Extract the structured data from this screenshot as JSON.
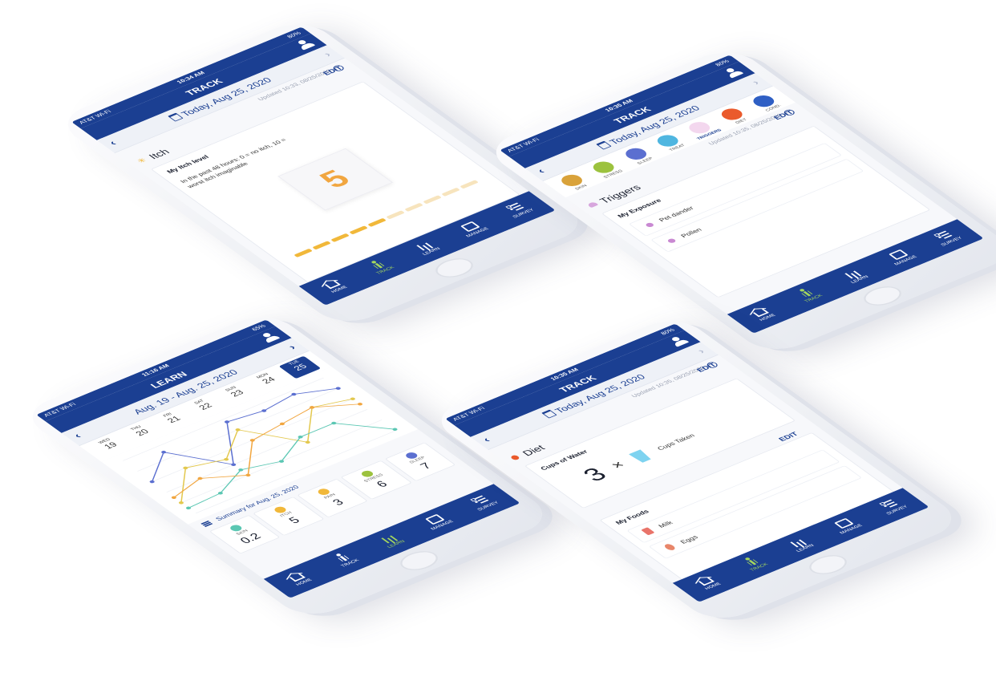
{
  "tabs": [
    "HOME",
    "TRACK",
    "LEARN",
    "MANAGE",
    "SURVEY"
  ],
  "track_itch": {
    "status": {
      "carrier": "AT&T Wi-Fi",
      "time": "10:34 AM",
      "battery": "80%"
    },
    "title": "TRACK",
    "date": "Today, Aug 25, 2020",
    "updated": "Updated 10:33, 08/25/2020",
    "section": "Itch",
    "edit": "EDIT",
    "card_title": "My Itch level",
    "question": "In the past 48 hours: 0 = no itch, 10 = worst itch imaginable",
    "value": "5",
    "scale_level": 0.5
  },
  "track_triggers": {
    "status": {
      "carrier": "AT&T Wi-Fi",
      "time": "10:35 AM",
      "battery": "80%"
    },
    "title": "TRACK",
    "date": "Today, Aug 25, 2020",
    "categories": [
      {
        "label": "SKIN",
        "color": "#d9a23a"
      },
      {
        "label": "STRESS",
        "color": "#9cc23e"
      },
      {
        "label": "SLEEP",
        "color": "#5b6fd0"
      },
      {
        "label": "TREAT",
        "color": "#4fb6e0"
      },
      {
        "label": "TRIGGERS",
        "color": "#f3d7ee"
      },
      {
        "label": "DIET",
        "color": "#ea5a2c"
      },
      {
        "label": "COND.",
        "color": "#2f5fc4"
      }
    ],
    "updated": "Updated 10:35, 08/25/2020",
    "section": "Triggers",
    "edit": "EDIT",
    "card_title": "My Exposure",
    "items": [
      "Pet dander",
      "Pollen"
    ]
  },
  "learn": {
    "status": {
      "carrier": "AT&T Wi-Fi",
      "time": "11:16 AM",
      "battery": "65%"
    },
    "title": "LEARN",
    "range": "Aug. 19 - Aug. 25, 2020",
    "days": [
      {
        "dow": "WED",
        "num": "19"
      },
      {
        "dow": "THU",
        "num": "20"
      },
      {
        "dow": "FRI",
        "num": "21"
      },
      {
        "dow": "SAT",
        "num": "22"
      },
      {
        "dow": "SUN",
        "num": "23"
      },
      {
        "dow": "MON",
        "num": "24"
      },
      {
        "dow": "TUE",
        "num": "25"
      }
    ],
    "summary_title": "Summary for Aug. 25, 2020",
    "metrics": [
      {
        "label": "SKIN",
        "value": "0.2",
        "color": "#5bc7b3"
      },
      {
        "label": "ITCH",
        "value": "5",
        "color": "#f1b83a"
      },
      {
        "label": "PAIN",
        "value": "3",
        "color": "#f1b83a"
      },
      {
        "label": "STRESS",
        "value": "6",
        "color": "#9cc23e"
      },
      {
        "label": "SLEEP",
        "value": "7",
        "color": "#5b6fd0"
      }
    ]
  },
  "chart_data": {
    "type": "line",
    "categories": [
      "19",
      "20",
      "21",
      "22",
      "23",
      "24",
      "25"
    ],
    "ylim": [
      0,
      10
    ],
    "series": [
      {
        "color": "#5b6fd0",
        "values": [
          6,
          9,
          4,
          9.5,
          9,
          9.5,
          8
        ]
      },
      {
        "color": "#e3c84e",
        "values": [
          2,
          6,
          5,
          8,
          3,
          7,
          6
        ]
      },
      {
        "color": "#5bc7b3",
        "values": [
          1,
          1.2,
          3,
          2,
          4,
          4,
          0.2
        ]
      },
      {
        "color": "#f1a640",
        "values": [
          3,
          4,
          2,
          6,
          6.5,
          7,
          5
        ]
      }
    ]
  },
  "track_diet": {
    "status": {
      "carrier": "AT&T Wi-Fi",
      "time": "10:35 AM",
      "battery": "80%"
    },
    "title": "TRACK",
    "date": "Today, Aug 25, 2020",
    "updated": "Updated 10:35, 08/25/2020",
    "section": "Diet",
    "edit": "EDIT",
    "water_title": "Cups of Water",
    "water_count": "3",
    "times": "×",
    "water_suffix": "Cups Taken",
    "foods_edit": "EDIT",
    "foods_title": "My Foods",
    "foods": [
      "Milk",
      "Eggs"
    ]
  }
}
